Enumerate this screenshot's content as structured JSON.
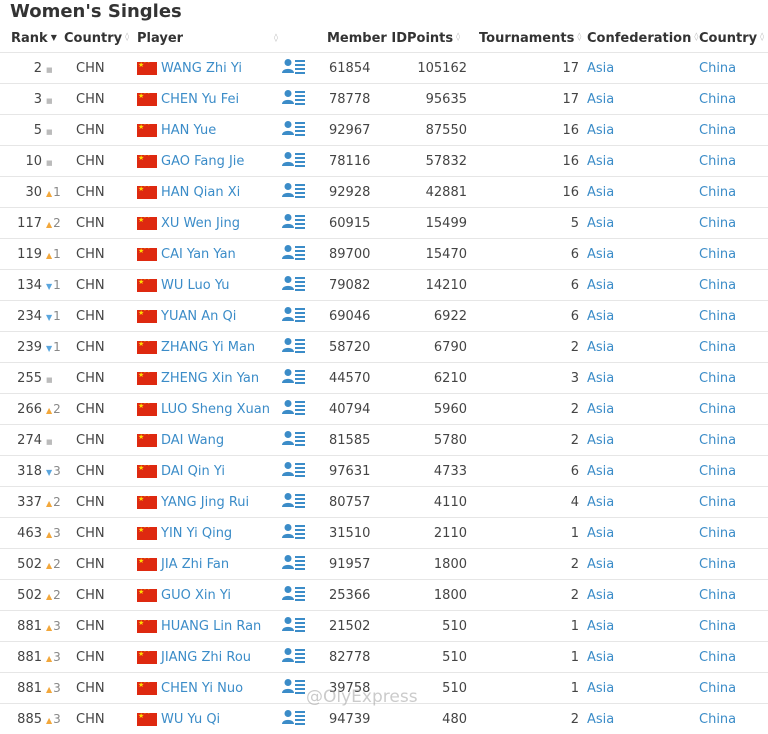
{
  "page": {
    "title": "Women's Singles",
    "watermark": "@OlyExpress"
  },
  "columns": {
    "rank": "Rank",
    "country": "Country",
    "player": "Player",
    "member_id": "Member ID",
    "points": "Points",
    "tournaments": "Tournaments",
    "confederation": "Confederation",
    "country2": "Country"
  },
  "colors": {
    "link": "#3b8cc8",
    "up": "#f2a73b",
    "down": "#5aa6de",
    "flag": "#de2910"
  },
  "rows": [
    {
      "rank": "2",
      "change_dir": "same",
      "change": "",
      "country": "CHN",
      "player": "WANG Zhi Yi",
      "member_id": "61854",
      "points": "105162",
      "tournaments": "17",
      "confederation": "Asia",
      "country_name": "China"
    },
    {
      "rank": "3",
      "change_dir": "same",
      "change": "",
      "country": "CHN",
      "player": "CHEN Yu Fei",
      "member_id": "78778",
      "points": "95635",
      "tournaments": "17",
      "confederation": "Asia",
      "country_name": "China"
    },
    {
      "rank": "5",
      "change_dir": "same",
      "change": "",
      "country": "CHN",
      "player": "HAN Yue",
      "member_id": "92967",
      "points": "87550",
      "tournaments": "16",
      "confederation": "Asia",
      "country_name": "China"
    },
    {
      "rank": "10",
      "change_dir": "same",
      "change": "",
      "country": "CHN",
      "player": "GAO Fang Jie",
      "member_id": "78116",
      "points": "57832",
      "tournaments": "16",
      "confederation": "Asia",
      "country_name": "China"
    },
    {
      "rank": "30",
      "change_dir": "up",
      "change": "1",
      "country": "CHN",
      "player": "HAN Qian Xi",
      "member_id": "92928",
      "points": "42881",
      "tournaments": "16",
      "confederation": "Asia",
      "country_name": "China"
    },
    {
      "rank": "117",
      "change_dir": "up",
      "change": "2",
      "country": "CHN",
      "player": "XU Wen Jing",
      "member_id": "60915",
      "points": "15499",
      "tournaments": "5",
      "confederation": "Asia",
      "country_name": "China"
    },
    {
      "rank": "119",
      "change_dir": "up",
      "change": "1",
      "country": "CHN",
      "player": "CAI Yan Yan",
      "member_id": "89700",
      "points": "15470",
      "tournaments": "6",
      "confederation": "Asia",
      "country_name": "China"
    },
    {
      "rank": "134",
      "change_dir": "down",
      "change": "1",
      "country": "CHN",
      "player": "WU Luo Yu",
      "member_id": "79082",
      "points": "14210",
      "tournaments": "6",
      "confederation": "Asia",
      "country_name": "China"
    },
    {
      "rank": "234",
      "change_dir": "down",
      "change": "1",
      "country": "CHN",
      "player": "YUAN An Qi",
      "member_id": "69046",
      "points": "6922",
      "tournaments": "6",
      "confederation": "Asia",
      "country_name": "China"
    },
    {
      "rank": "239",
      "change_dir": "down",
      "change": "1",
      "country": "CHN",
      "player": "ZHANG Yi Man",
      "member_id": "58720",
      "points": "6790",
      "tournaments": "2",
      "confederation": "Asia",
      "country_name": "China"
    },
    {
      "rank": "255",
      "change_dir": "same",
      "change": "",
      "country": "CHN",
      "player": "ZHENG Xin Yan",
      "member_id": "44570",
      "points": "6210",
      "tournaments": "3",
      "confederation": "Asia",
      "country_name": "China"
    },
    {
      "rank": "266",
      "change_dir": "up",
      "change": "2",
      "country": "CHN",
      "player": "LUO Sheng Xuan",
      "member_id": "40794",
      "points": "5960",
      "tournaments": "2",
      "confederation": "Asia",
      "country_name": "China"
    },
    {
      "rank": "274",
      "change_dir": "same",
      "change": "",
      "country": "CHN",
      "player": "DAI Wang",
      "member_id": "81585",
      "points": "5780",
      "tournaments": "2",
      "confederation": "Asia",
      "country_name": "China"
    },
    {
      "rank": "318",
      "change_dir": "down",
      "change": "3",
      "country": "CHN",
      "player": "DAI Qin Yi",
      "member_id": "97631",
      "points": "4733",
      "tournaments": "6",
      "confederation": "Asia",
      "country_name": "China"
    },
    {
      "rank": "337",
      "change_dir": "up",
      "change": "2",
      "country": "CHN",
      "player": "YANG Jing Rui",
      "member_id": "80757",
      "points": "4110",
      "tournaments": "4",
      "confederation": "Asia",
      "country_name": "China"
    },
    {
      "rank": "463",
      "change_dir": "up",
      "change": "3",
      "country": "CHN",
      "player": "YIN Yi Qing",
      "member_id": "31510",
      "points": "2110",
      "tournaments": "1",
      "confederation": "Asia",
      "country_name": "China"
    },
    {
      "rank": "502",
      "change_dir": "up",
      "change": "2",
      "country": "CHN",
      "player": "JIA Zhi Fan",
      "member_id": "91957",
      "points": "1800",
      "tournaments": "2",
      "confederation": "Asia",
      "country_name": "China"
    },
    {
      "rank": "502",
      "change_dir": "up",
      "change": "2",
      "country": "CHN",
      "player": "GUO Xin Yi",
      "member_id": "25366",
      "points": "1800",
      "tournaments": "2",
      "confederation": "Asia",
      "country_name": "China"
    },
    {
      "rank": "881",
      "change_dir": "up",
      "change": "3",
      "country": "CHN",
      "player": "HUANG Lin Ran",
      "member_id": "21502",
      "points": "510",
      "tournaments": "1",
      "confederation": "Asia",
      "country_name": "China"
    },
    {
      "rank": "881",
      "change_dir": "up",
      "change": "3",
      "country": "CHN",
      "player": "JIANG Zhi Rou",
      "member_id": "82778",
      "points": "510",
      "tournaments": "1",
      "confederation": "Asia",
      "country_name": "China"
    },
    {
      "rank": "881",
      "change_dir": "up",
      "change": "3",
      "country": "CHN",
      "player": "CHEN Yi Nuo",
      "member_id": "39758",
      "points": "510",
      "tournaments": "1",
      "confederation": "Asia",
      "country_name": "China"
    },
    {
      "rank": "885",
      "change_dir": "up",
      "change": "3",
      "country": "CHN",
      "player": "WU Yu Qi",
      "member_id": "94739",
      "points": "480",
      "tournaments": "2",
      "confederation": "Asia",
      "country_name": "China"
    }
  ]
}
